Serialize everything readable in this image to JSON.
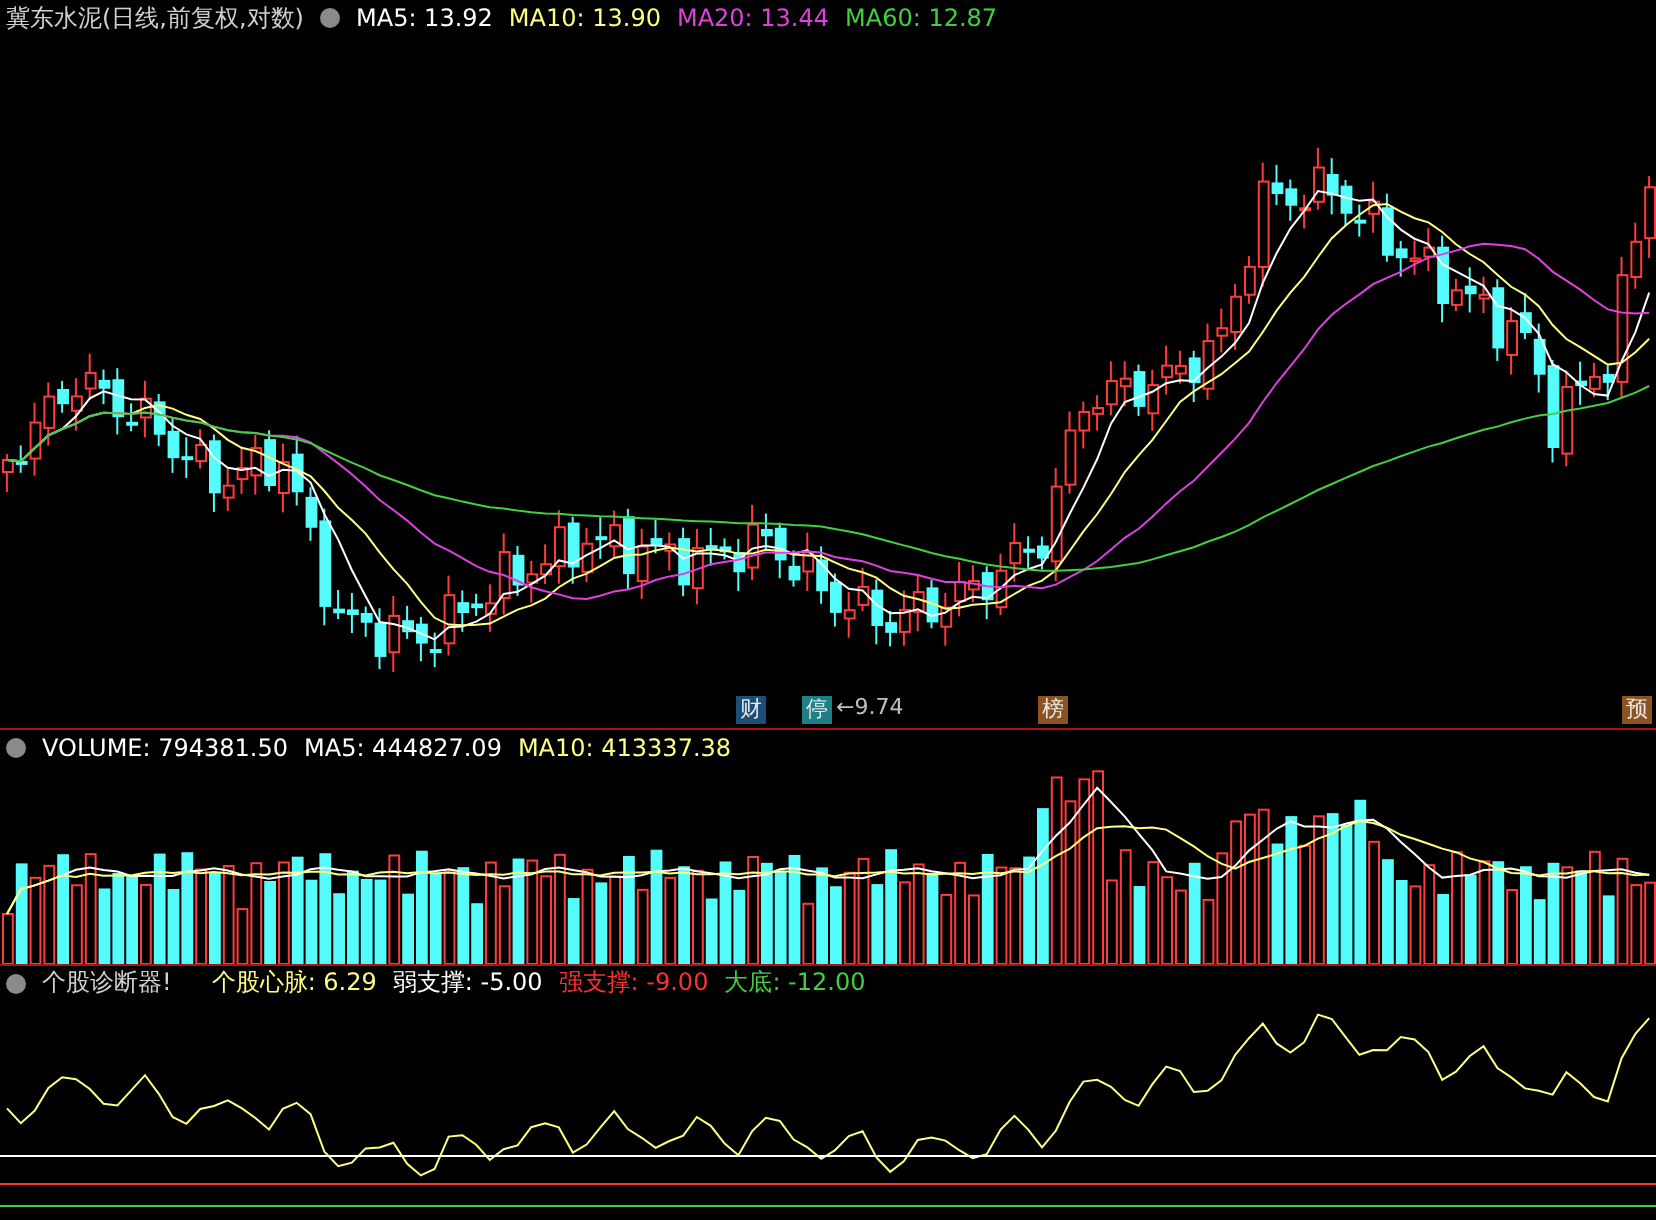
{
  "price_panel": {
    "title": "冀东水泥(日线,前复权,对数)",
    "indicators": [
      {
        "label": "MA5: 13.92",
        "color": "#ffffff"
      },
      {
        "label": "MA10: 13.90",
        "color": "#ffff80"
      },
      {
        "label": "MA20: 13.44",
        "color": "#e040e0"
      },
      {
        "label": "MA60: 12.87",
        "color": "#40d040"
      }
    ],
    "event_markers": [
      {
        "label": "财",
        "color": "#1c4f78"
      },
      {
        "label": "停",
        "color": "#1f7f86"
      },
      {
        "label": "榜",
        "color": "#8a5320"
      },
      {
        "label": "预",
        "color": "#8a5320"
      }
    ],
    "low_label": "←9.74"
  },
  "volume_panel": {
    "indicators": [
      {
        "label": "VOLUME: 794381.50",
        "color": "#ffffff"
      },
      {
        "label": "MA5: 444827.09",
        "color": "#ffffff"
      },
      {
        "label": "MA10: 413337.38",
        "color": "#ffff80"
      }
    ]
  },
  "diagnosis_panel": {
    "title": "个股诊断器!",
    "indicators": [
      {
        "label": "个股心脉: 6.29",
        "color": "#ffff80"
      },
      {
        "label": "弱支撑: -5.00",
        "color": "#ffffff"
      },
      {
        "label": "强支撑: -9.00",
        "color": "#ff3030"
      },
      {
        "label": "大底: -12.00",
        "color": "#40d040"
      }
    ]
  }
}
